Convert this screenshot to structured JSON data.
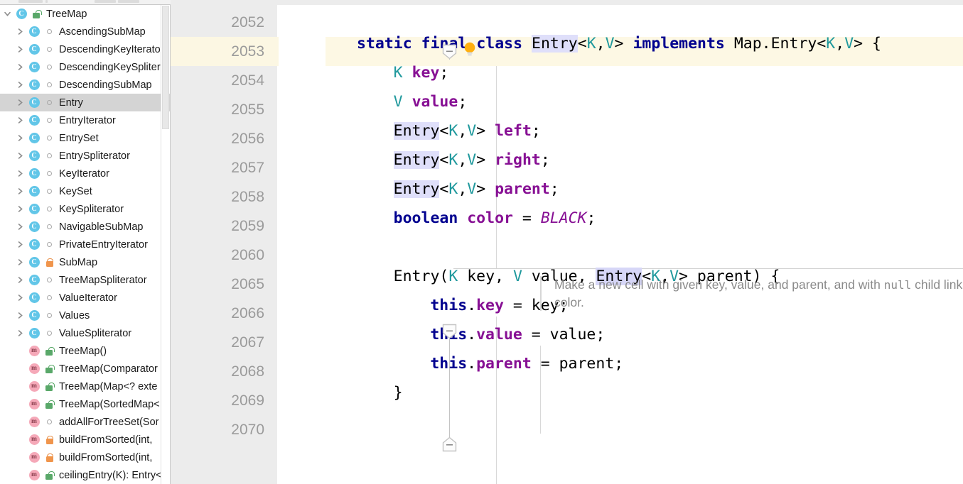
{
  "window": {
    "toolbar_visible": true
  },
  "sidebar": {
    "name": "structure-tool-window",
    "scrollbar": {
      "position": "top"
    },
    "items": [
      {
        "label": "TreeMap",
        "kind": "class",
        "icon": "class-icon",
        "visibility": "lock-green",
        "depth": 1,
        "expanded": true,
        "selected": false,
        "has_arrow": true
      },
      {
        "label": "AscendingSubMap",
        "kind": "class",
        "icon": "class-icon",
        "visibility": "pkg-private",
        "depth": 2,
        "expanded": false,
        "selected": false,
        "has_arrow": true
      },
      {
        "label": "DescendingKeyIterato",
        "kind": "class",
        "icon": "class-icon",
        "visibility": "pkg-private",
        "depth": 2,
        "expanded": false,
        "selected": false,
        "has_arrow": true
      },
      {
        "label": "DescendingKeySpliter",
        "kind": "class",
        "icon": "class-icon",
        "visibility": "pkg-private",
        "depth": 2,
        "expanded": false,
        "selected": false,
        "has_arrow": true
      },
      {
        "label": "DescendingSubMap",
        "kind": "class",
        "icon": "class-icon",
        "visibility": "pkg-private",
        "depth": 2,
        "expanded": false,
        "selected": false,
        "has_arrow": true
      },
      {
        "label": "Entry",
        "kind": "class",
        "icon": "class-icon",
        "visibility": "pkg-private",
        "depth": 2,
        "expanded": false,
        "selected": true,
        "has_arrow": true
      },
      {
        "label": "EntryIterator",
        "kind": "class",
        "icon": "class-icon",
        "visibility": "pkg-private",
        "depth": 2,
        "expanded": false,
        "selected": false,
        "has_arrow": true
      },
      {
        "label": "EntrySet",
        "kind": "class",
        "icon": "class-icon",
        "visibility": "pkg-private",
        "depth": 2,
        "expanded": false,
        "selected": false,
        "has_arrow": true
      },
      {
        "label": "EntrySpliterator",
        "kind": "class",
        "icon": "class-icon",
        "visibility": "pkg-private",
        "depth": 2,
        "expanded": false,
        "selected": false,
        "has_arrow": true
      },
      {
        "label": "KeyIterator",
        "kind": "class",
        "icon": "class-icon",
        "visibility": "pkg-private",
        "depth": 2,
        "expanded": false,
        "selected": false,
        "has_arrow": true
      },
      {
        "label": "KeySet",
        "kind": "class",
        "icon": "class-icon",
        "visibility": "pkg-private",
        "depth": 2,
        "expanded": false,
        "selected": false,
        "has_arrow": true
      },
      {
        "label": "KeySpliterator",
        "kind": "class",
        "icon": "class-icon",
        "visibility": "pkg-private",
        "depth": 2,
        "expanded": false,
        "selected": false,
        "has_arrow": true
      },
      {
        "label": "NavigableSubMap",
        "kind": "class",
        "icon": "class-icon",
        "visibility": "pkg-private",
        "depth": 2,
        "expanded": false,
        "selected": false,
        "has_arrow": true
      },
      {
        "label": "PrivateEntryIterator",
        "kind": "class",
        "icon": "class-icon",
        "visibility": "pkg-private",
        "depth": 2,
        "expanded": false,
        "selected": false,
        "has_arrow": true
      },
      {
        "label": "SubMap",
        "kind": "class",
        "icon": "class-icon",
        "visibility": "lock-orange",
        "depth": 2,
        "expanded": false,
        "selected": false,
        "has_arrow": true
      },
      {
        "label": "TreeMapSpliterator",
        "kind": "class",
        "icon": "class-icon",
        "visibility": "pkg-private",
        "depth": 2,
        "expanded": false,
        "selected": false,
        "has_arrow": true
      },
      {
        "label": "ValueIterator",
        "kind": "class",
        "icon": "class-icon",
        "visibility": "pkg-private",
        "depth": 2,
        "expanded": false,
        "selected": false,
        "has_arrow": true
      },
      {
        "label": "Values",
        "kind": "class",
        "icon": "class-icon",
        "visibility": "pkg-private",
        "depth": 2,
        "expanded": false,
        "selected": false,
        "has_arrow": true
      },
      {
        "label": "ValueSpliterator",
        "kind": "class",
        "icon": "class-icon",
        "visibility": "pkg-private",
        "depth": 2,
        "expanded": false,
        "selected": false,
        "has_arrow": true
      },
      {
        "label": "TreeMap()",
        "kind": "method",
        "icon": "method-icon",
        "visibility": "lock-green",
        "depth": 2,
        "expanded": false,
        "selected": false,
        "has_arrow": false
      },
      {
        "label": "TreeMap(Comparator",
        "kind": "method",
        "icon": "method-icon",
        "visibility": "lock-green",
        "depth": 2,
        "expanded": false,
        "selected": false,
        "has_arrow": false
      },
      {
        "label": "TreeMap(Map<? exte",
        "kind": "method",
        "icon": "method-icon",
        "visibility": "lock-green",
        "depth": 2,
        "expanded": false,
        "selected": false,
        "has_arrow": false
      },
      {
        "label": "TreeMap(SortedMap<",
        "kind": "method",
        "icon": "method-icon",
        "visibility": "lock-green",
        "depth": 2,
        "expanded": false,
        "selected": false,
        "has_arrow": false
      },
      {
        "label": "addAllForTreeSet(Sor",
        "kind": "method",
        "icon": "method-icon",
        "visibility": "pkg-private",
        "depth": 2,
        "expanded": false,
        "selected": false,
        "has_arrow": false
      },
      {
        "label": "buildFromSorted(int,",
        "kind": "method",
        "icon": "method-icon",
        "visibility": "lock-orange",
        "depth": 2,
        "expanded": false,
        "selected": false,
        "has_arrow": false
      },
      {
        "label": "buildFromSorted(int,",
        "kind": "method",
        "icon": "method-icon",
        "visibility": "lock-orange",
        "depth": 2,
        "expanded": false,
        "selected": false,
        "has_arrow": false
      },
      {
        "label": "ceilingEntry(K): Entry<",
        "kind": "method",
        "icon": "method-icon",
        "visibility": "lock-green",
        "depth": 2,
        "expanded": false,
        "selected": false,
        "has_arrow": false
      }
    ]
  },
  "editor": {
    "name": "code-editor",
    "current_line": 2053,
    "line_numbers": [
      "2052",
      "2053",
      "2054",
      "2055",
      "2056",
      "2057",
      "2058",
      "2059",
      "2060",
      "2065",
      "2066",
      "2067",
      "2068",
      "2069",
      "2070"
    ],
    "gutter_icons": {
      "intention_bulb": "lightbulb-icon",
      "fold_collapse": "fold-collapse-icon",
      "fold_expand": "fold-expand-icon"
    },
    "javadoc": {
      "text_before": "Make a new cell with given key, value, and parent, and with ",
      "code_token": "null",
      "text_after": " child links, and BLACK color."
    },
    "code_lines": [
      {
        "line": "2052",
        "tokens": []
      },
      {
        "line": "2053",
        "tokens": [
          {
            "t": "static",
            "c": "kw"
          },
          {
            "t": " ",
            "c": "plain"
          },
          {
            "t": "final",
            "c": "kw"
          },
          {
            "t": " ",
            "c": "plain"
          },
          {
            "t": "class",
            "c": "kw"
          },
          {
            "t": " ",
            "c": "plain"
          },
          {
            "t": "Entry",
            "c": "plain",
            "hl": "hl"
          },
          {
            "t": "<",
            "c": "plain"
          },
          {
            "t": "K",
            "c": "type"
          },
          {
            "t": ",",
            "c": "plain"
          },
          {
            "t": "V",
            "c": "type"
          },
          {
            "t": "> ",
            "c": "plain"
          },
          {
            "t": "implements",
            "c": "kw"
          },
          {
            "t": " Map.Entry<",
            "c": "plain"
          },
          {
            "t": "K",
            "c": "type"
          },
          {
            "t": ",",
            "c": "plain"
          },
          {
            "t": "V",
            "c": "type"
          },
          {
            "t": "> {",
            "c": "plain"
          }
        ]
      },
      {
        "line": "2054",
        "indent": 1,
        "tokens": [
          {
            "t": "K",
            "c": "type"
          },
          {
            "t": " ",
            "c": "plain"
          },
          {
            "t": "key",
            "c": "field bold"
          },
          {
            "t": ";",
            "c": "plain"
          }
        ]
      },
      {
        "line": "2055",
        "indent": 1,
        "tokens": [
          {
            "t": "V",
            "c": "type"
          },
          {
            "t": " ",
            "c": "plain"
          },
          {
            "t": "value",
            "c": "field bold"
          },
          {
            "t": ";",
            "c": "plain"
          }
        ]
      },
      {
        "line": "2056",
        "indent": 1,
        "tokens": [
          {
            "t": "Entry",
            "c": "plain",
            "hl": "hl"
          },
          {
            "t": "<",
            "c": "plain"
          },
          {
            "t": "K",
            "c": "type"
          },
          {
            "t": ",",
            "c": "plain"
          },
          {
            "t": "V",
            "c": "type"
          },
          {
            "t": "> ",
            "c": "plain"
          },
          {
            "t": "left",
            "c": "field bold"
          },
          {
            "t": ";",
            "c": "plain"
          }
        ]
      },
      {
        "line": "2057",
        "indent": 1,
        "tokens": [
          {
            "t": "Entry",
            "c": "plain",
            "hl": "hl"
          },
          {
            "t": "<",
            "c": "plain"
          },
          {
            "t": "K",
            "c": "type"
          },
          {
            "t": ",",
            "c": "plain"
          },
          {
            "t": "V",
            "c": "type"
          },
          {
            "t": "> ",
            "c": "plain"
          },
          {
            "t": "right",
            "c": "field bold"
          },
          {
            "t": ";",
            "c": "plain"
          }
        ]
      },
      {
        "line": "2058",
        "indent": 1,
        "tokens": [
          {
            "t": "Entry",
            "c": "plain",
            "hl": "hl"
          },
          {
            "t": "<",
            "c": "plain"
          },
          {
            "t": "K",
            "c": "type"
          },
          {
            "t": ",",
            "c": "plain"
          },
          {
            "t": "V",
            "c": "type"
          },
          {
            "t": "> ",
            "c": "plain"
          },
          {
            "t": "parent",
            "c": "field bold"
          },
          {
            "t": ";",
            "c": "plain"
          }
        ]
      },
      {
        "line": "2059",
        "indent": 1,
        "tokens": [
          {
            "t": "boolean",
            "c": "kw"
          },
          {
            "t": " ",
            "c": "plain"
          },
          {
            "t": "color",
            "c": "field bold"
          },
          {
            "t": " = ",
            "c": "plain"
          },
          {
            "t": "BLACK",
            "c": "fieldi"
          },
          {
            "t": ";",
            "c": "plain"
          }
        ]
      },
      {
        "line": "2060",
        "tokens": []
      },
      {
        "line": "2065",
        "indent": 1,
        "tokens": [
          {
            "t": "Entry(",
            "c": "plain",
            "hl_part": true
          },
          {
            "t": "K",
            "c": "type"
          },
          {
            "t": " key, ",
            "c": "plain"
          },
          {
            "t": "V",
            "c": "type"
          },
          {
            "t": " value, ",
            "c": "plain"
          },
          {
            "t": "Entry",
            "c": "plain",
            "hl": "hl-strong"
          },
          {
            "t": "<",
            "c": "plain"
          },
          {
            "t": "K",
            "c": "type"
          },
          {
            "t": ",",
            "c": "plain"
          },
          {
            "t": "V",
            "c": "type"
          },
          {
            "t": "> parent) {",
            "c": "plain"
          }
        ]
      },
      {
        "line": "2066",
        "indent": 2,
        "tokens": [
          {
            "t": "this",
            "c": "kw"
          },
          {
            "t": ".",
            "c": "plain"
          },
          {
            "t": "key",
            "c": "field bold"
          },
          {
            "t": " = key;",
            "c": "plain"
          }
        ]
      },
      {
        "line": "2067",
        "indent": 2,
        "tokens": [
          {
            "t": "this",
            "c": "kw"
          },
          {
            "t": ".",
            "c": "plain"
          },
          {
            "t": "value",
            "c": "field bold"
          },
          {
            "t": " = value;",
            "c": "plain"
          }
        ]
      },
      {
        "line": "2068",
        "indent": 2,
        "tokens": [
          {
            "t": "this",
            "c": "kw"
          },
          {
            "t": ".",
            "c": "plain"
          },
          {
            "t": "parent",
            "c": "field bold"
          },
          {
            "t": " = parent;",
            "c": "plain"
          }
        ]
      },
      {
        "line": "2069",
        "indent": 1,
        "tokens": [
          {
            "t": "}",
            "c": "plain"
          }
        ]
      },
      {
        "line": "2070",
        "tokens": []
      }
    ]
  },
  "colors": {
    "keyword": "#00008F",
    "type_param": "#20999D",
    "field": "#871094",
    "highlight": "#DFDFFA",
    "highlight_strong": "#D6D6F7",
    "current_line": "#FDF8E4",
    "gutter": "#ECECEC",
    "selection": "#D4D4D4",
    "class_icon": "#62C6E8",
    "method_icon": "#F5A8B8",
    "lock_green": "#59A869",
    "lock_orange": "#F0954C",
    "bulb": "#FFAF0F"
  }
}
